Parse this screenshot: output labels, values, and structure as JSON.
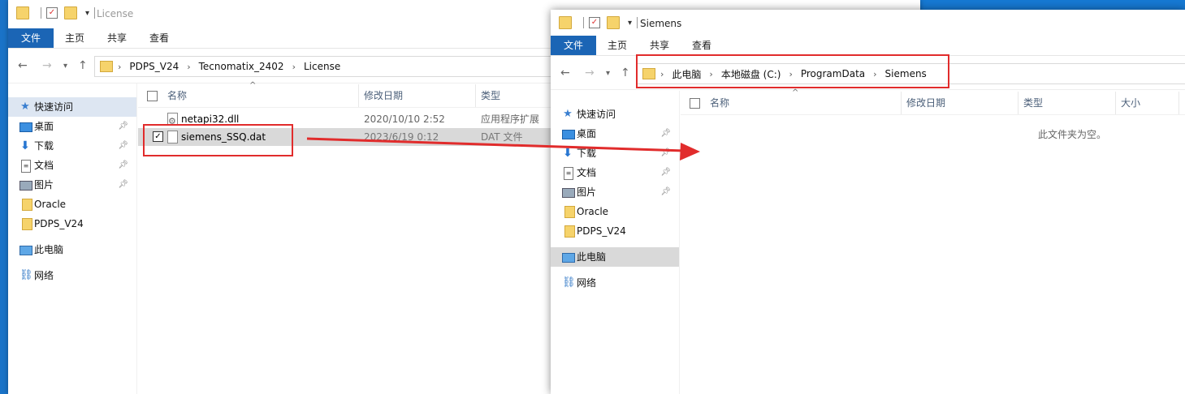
{
  "colors": {
    "accent": "#1b65b5",
    "highlight": "#e12c2c",
    "folder": "#f6d36b"
  },
  "left_window": {
    "title": "License",
    "ribbon": [
      "文件",
      "主页",
      "共享",
      "查看"
    ],
    "path": [
      "PDPS_V24",
      "Tecnomatix_2402",
      "License"
    ],
    "sidebar": [
      {
        "label": "快速访问",
        "icon": "star-icon"
      },
      {
        "label": "桌面",
        "icon": "desktop-icon",
        "pinned": true
      },
      {
        "label": "下载",
        "icon": "download-icon",
        "pinned": true
      },
      {
        "label": "文档",
        "icon": "document-icon",
        "pinned": true
      },
      {
        "label": "图片",
        "icon": "pictures-icon",
        "pinned": true
      },
      {
        "label": "Oracle",
        "icon": "folder-icon"
      },
      {
        "label": "PDPS_V24",
        "icon": "folder-icon"
      },
      {
        "label": "此电脑",
        "icon": "computer-icon"
      },
      {
        "label": "网络",
        "icon": "network-icon"
      }
    ],
    "columns": [
      "名称",
      "修改日期",
      "类型"
    ],
    "files": [
      {
        "name": "netapi32.dll",
        "date": "2020/10/10 2:52",
        "type": "应用程序扩展"
      },
      {
        "name": "siemens_SSQ.dat",
        "date": "2023/6/19 0:12",
        "type": "DAT 文件"
      }
    ]
  },
  "right_window": {
    "title": "Siemens",
    "ribbon": [
      "文件",
      "主页",
      "共享",
      "查看"
    ],
    "path": [
      "此电脑",
      "本地磁盘 (C:)",
      "ProgramData",
      "Siemens"
    ],
    "sidebar": [
      {
        "label": "快速访问",
        "icon": "star-icon"
      },
      {
        "label": "桌面",
        "icon": "desktop-icon",
        "pinned": true
      },
      {
        "label": "下载",
        "icon": "download-icon",
        "pinned": true
      },
      {
        "label": "文档",
        "icon": "document-icon",
        "pinned": true
      },
      {
        "label": "图片",
        "icon": "pictures-icon",
        "pinned": true
      },
      {
        "label": "Oracle",
        "icon": "folder-icon"
      },
      {
        "label": "PDPS_V24",
        "icon": "folder-icon"
      },
      {
        "label": "此电脑",
        "icon": "computer-icon"
      },
      {
        "label": "网络",
        "icon": "network-icon"
      }
    ],
    "columns": [
      "名称",
      "修改日期",
      "类型",
      "大小"
    ],
    "empty_message": "此文件夹为空。"
  }
}
